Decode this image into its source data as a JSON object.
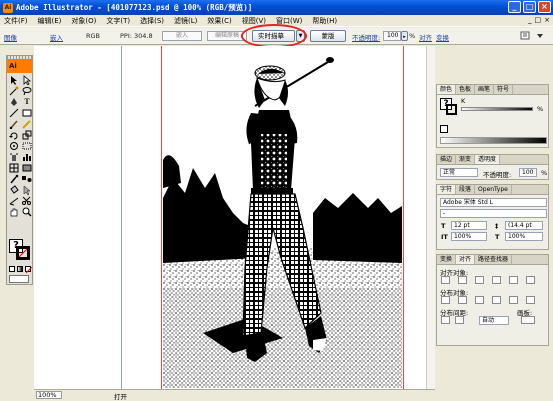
{
  "window": {
    "app_icon": "Ai",
    "title": "Adobe Illustrator - [401077123.psd @ 100% (RGB/预览)]",
    "buttons": [
      "_",
      "□",
      "×"
    ]
  },
  "menubar": {
    "items": [
      "文件(F)",
      "编辑(E)",
      "对象(O)",
      "文字(T)",
      "选择(S)",
      "滤镜(L)",
      "效果(C)",
      "视图(V)",
      "窗口(W)",
      "帮助(H)"
    ],
    "mdi_buttons": [
      "_",
      "□",
      "×"
    ]
  },
  "controlbar": {
    "image_label": "图像",
    "embed_label": "嵌入",
    "color_mode": "RGB",
    "ppi": "PPI: 304.8",
    "embed_field": "嵌入",
    "edit_original": "编辑原稿",
    "live_trace": "实时描摹",
    "mask": "蒙版",
    "opacity_label": "不透明度:",
    "opacity_value": "100",
    "percent": "%",
    "align_label": "对齐",
    "transform_label": "变换"
  },
  "toolbox": {
    "logo": "Ai",
    "type_tool_glyph": "T",
    "fill_stroke_glyph": "?"
  },
  "color_panel": {
    "tabs": [
      "颜色",
      "色板",
      "画笔",
      "符号"
    ],
    "k_label": "K",
    "percent": "%"
  },
  "transparency_panel": {
    "tabs": [
      "描边",
      "渐变",
      "透明度"
    ],
    "blend_mode": "正常",
    "opacity_label": "不透明度:",
    "opacity_value": "100",
    "percent": "%"
  },
  "character_panel": {
    "tabs": [
      "字符",
      "段落",
      "OpenType"
    ],
    "font": "Adobe 宋体 Std L",
    "style": "-",
    "size": "12 pt",
    "leading": "(14.4 pt",
    "h_scale": "100%",
    "v_scale": "100%",
    "tracking": "自动",
    "kerning": "0"
  },
  "align_panel": {
    "tabs": [
      "变换",
      "对齐",
      "路径查找器"
    ],
    "align_objects": "对齐对象:",
    "distribute_objects": "分布对象:",
    "distribute_spacing": "分布间距:",
    "spacing_value": "自动",
    "align_to": "画板:"
  },
  "statusbar": {
    "zoom": "100%",
    "status": "打开"
  },
  "colors": {
    "title_bar": "#0050d8",
    "highlight": "#e0261b",
    "ai_logo": "#ff7c00"
  }
}
